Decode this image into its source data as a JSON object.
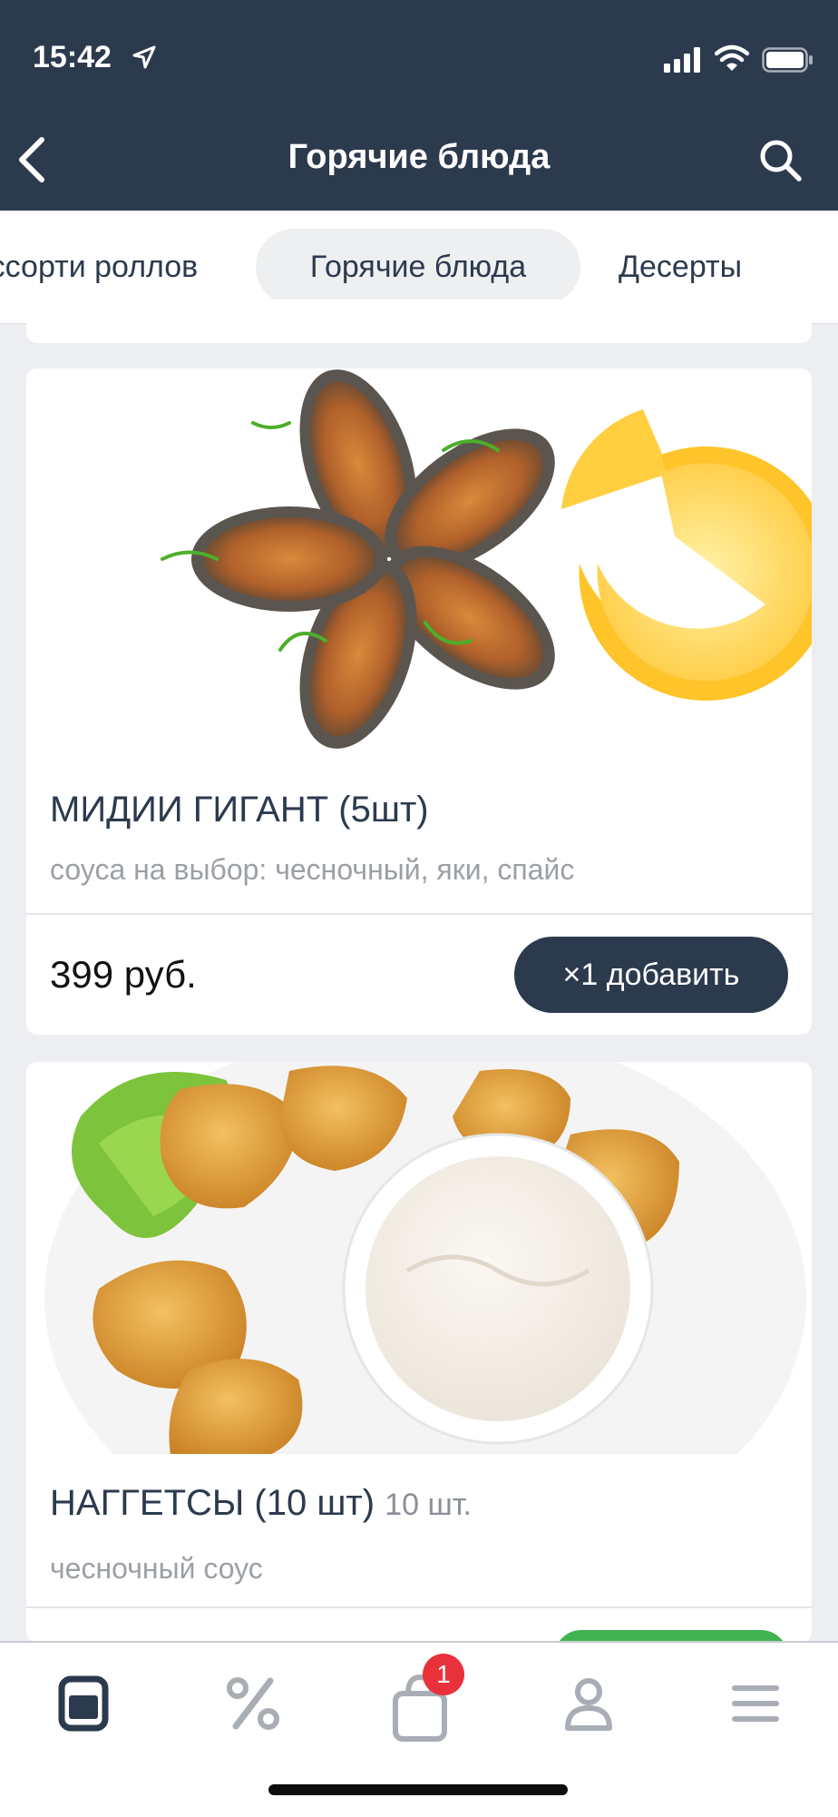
{
  "status_bar": {
    "time": "15:42"
  },
  "header": {
    "title": "Горячие блюда"
  },
  "tabs": [
    {
      "label": "Ассорти роллов"
    },
    {
      "label": "Горячие блюда"
    },
    {
      "label": "Десерты"
    }
  ],
  "items": [
    {
      "name": "МИДИИ ГИГАНТ (5шт)",
      "qty": "",
      "description": "соуса на выбор: чесночный, яки, спайс",
      "price": "399 руб.",
      "add_label": "×1 добавить"
    },
    {
      "name": "НАГГЕТСЫ (10 шт)",
      "qty": "10 шт.",
      "description": "чесночный соус"
    }
  ],
  "bottom_nav": {
    "items": [
      {
        "icon": "menu-card-icon"
      },
      {
        "icon": "percent-icon"
      },
      {
        "icon": "cart-bag-icon"
      },
      {
        "icon": "profile-icon"
      },
      {
        "icon": "hamburger-icon"
      }
    ],
    "cart_badge": "1"
  },
  "colors": {
    "header_bg": "#2c3a4e",
    "accent_green": "#3fb34f",
    "badge_red": "#e8313b"
  }
}
